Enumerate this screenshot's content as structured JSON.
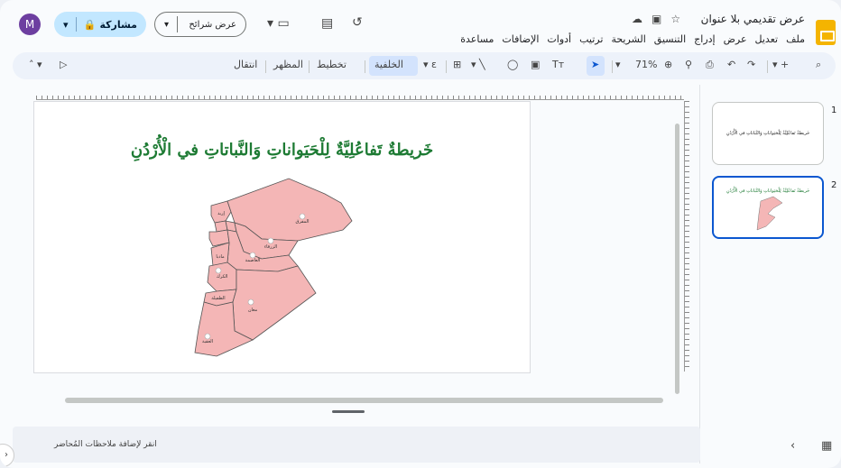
{
  "app": {
    "doc_title": "عرض تقديمي بلا عنوان",
    "title_icons": [
      "star-icon",
      "folder-move-icon",
      "cloud-status-icon"
    ]
  },
  "menu": [
    "ملف",
    "تعديل",
    "عرض",
    "إدراج",
    "التنسيق",
    "الشريحة",
    "ترتيب",
    "أدوات",
    "الإضافات",
    "مساعدة"
  ],
  "account": {
    "avatar_letter": "M"
  },
  "share": {
    "label": "مشاركة"
  },
  "slideshow": {
    "label": "عرض شرائح"
  },
  "toolbar": {
    "zoom": "71%",
    "transition": "انتقال",
    "theme": "المظهر",
    "layout": "تخطيط",
    "background": "الخلفية"
  },
  "slide": {
    "title": "خَريطةٌ تَفاعُلِيَّةٌ لِلْحَيَواناتِ وَالنَّباتاتِ في الْأُرْدُنِ"
  },
  "map": {
    "regions": [
      "عجلون",
      "جرش",
      "البلقاء",
      "مادبا",
      "الكرك",
      "الطفيلة",
      "معان",
      "العقبة",
      "العاصمة",
      "الزرقاء",
      "المفرق",
      "إربد"
    ],
    "fill": "#f4b6b6",
    "stroke": "#555"
  },
  "filmstrip": {
    "slides": [
      {
        "number": "1",
        "caption": "خَريطةٌ تَفاعُلِيَّةٌ لِلْحَيَواناتِ وَالنَّباتاتِ في الْأُرْدُنِ"
      },
      {
        "number": "2",
        "caption": "خَريطةٌ تَفاعُلِيَّةٌ لِلْحَيَواناتِ وَالنَّباتاتِ في الْأُرْدُنِ"
      }
    ]
  },
  "notes": {
    "placeholder": "انقر لإضافة ملاحظات المُحاضر"
  },
  "colors": {
    "accent": "#0b57d0",
    "share_bg": "#c2e7ff",
    "title_green": "#1e7b34"
  }
}
